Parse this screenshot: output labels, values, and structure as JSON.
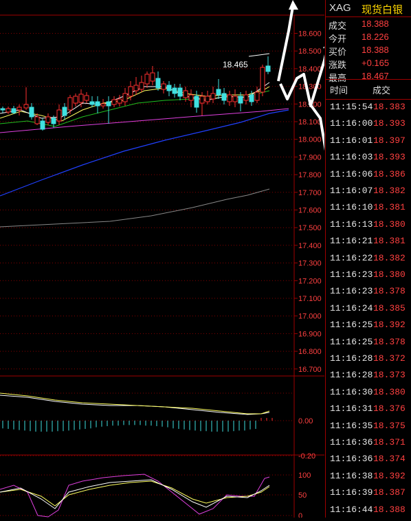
{
  "header": {
    "symbol": "XAG",
    "name": "现货白银"
  },
  "quote": [
    {
      "label": "成交",
      "value": "18.388"
    },
    {
      "label": "今开",
      "value": "18.226"
    },
    {
      "label": "买价",
      "value": "18.388"
    },
    {
      "label": "涨跌",
      "value": "+0.165"
    },
    {
      "label": "最高",
      "value": "18.467"
    }
  ],
  "trades_header": {
    "time": "时间",
    "price": "成交"
  },
  "trades": [
    {
      "time": "11:15:54",
      "price": "18.383"
    },
    {
      "time": "11:16:00",
      "price": "18.393"
    },
    {
      "time": "11:16:01",
      "price": "18.397"
    },
    {
      "time": "11:16:03",
      "price": "18.393"
    },
    {
      "time": "11:16:06",
      "price": "18.386"
    },
    {
      "time": "11:16:07",
      "price": "18.382"
    },
    {
      "time": "11:16:10",
      "price": "18.381"
    },
    {
      "time": "11:16:13",
      "price": "18.380"
    },
    {
      "time": "11:16:21",
      "price": "18.381"
    },
    {
      "time": "11:16:22",
      "price": "18.382"
    },
    {
      "time": "11:16:23",
      "price": "18.380"
    },
    {
      "time": "11:16:23",
      "price": "18.378"
    },
    {
      "time": "11:16:24",
      "price": "18.385"
    },
    {
      "time": "11:16:25",
      "price": "18.392"
    },
    {
      "time": "11:16:25",
      "price": "18.378"
    },
    {
      "time": "11:16:28",
      "price": "18.372"
    },
    {
      "time": "11:16:28",
      "price": "18.373"
    },
    {
      "time": "11:16:30",
      "price": "18.380"
    },
    {
      "time": "11:16:31",
      "price": "18.376"
    },
    {
      "time": "11:16:35",
      "price": "18.375"
    },
    {
      "time": "11:16:36",
      "price": "18.371"
    },
    {
      "time": "11:16:36",
      "price": "18.374"
    },
    {
      "time": "11:16:38",
      "price": "18.392"
    },
    {
      "time": "11:16:39",
      "price": "18.387"
    },
    {
      "time": "11:16:44",
      "price": "18.388"
    }
  ],
  "chart": {
    "price_axis": [
      "18.600",
      "18.500",
      "18.400",
      "18.300",
      "18.200",
      "18.100",
      "18.000",
      "17.900",
      "17.800",
      "17.700",
      "17.600",
      "17.500",
      "17.400",
      "17.300",
      "17.200",
      "17.100",
      "17.000",
      "16.900",
      "16.800",
      "16.700"
    ],
    "high_marker": "18.465",
    "macd_axis": [
      "0.00",
      "-0.20"
    ],
    "kdj_axis": [
      "100",
      "50",
      "0"
    ],
    "colors": {
      "up": "#ff3030",
      "down": "#40e0e0",
      "grid": "#a00000",
      "axis_text": "#ff4040"
    }
  }
}
